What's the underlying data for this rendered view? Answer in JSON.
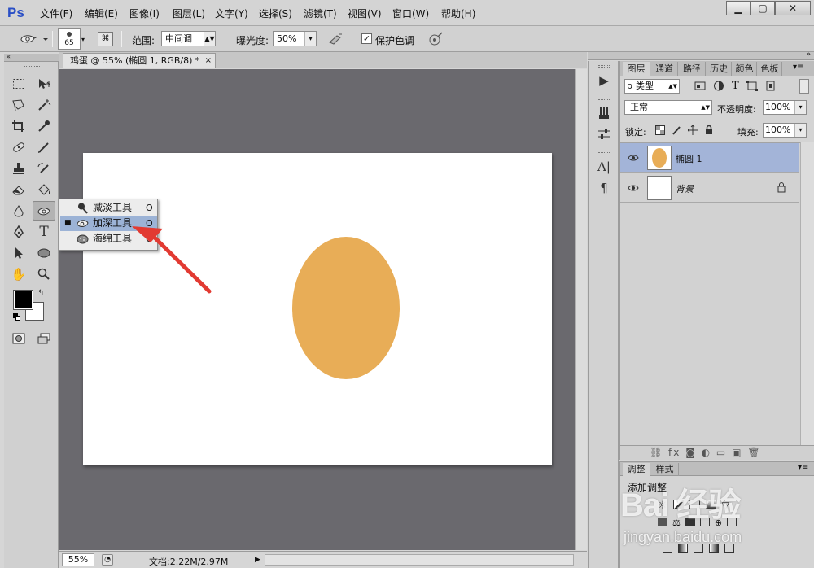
{
  "app": {
    "logo": "Ps"
  },
  "menu": [
    {
      "label": "文件(F)"
    },
    {
      "label": "编辑(E)"
    },
    {
      "label": "图像(I)"
    },
    {
      "label": "图层(L)"
    },
    {
      "label": "文字(Y)"
    },
    {
      "label": "选择(S)"
    },
    {
      "label": "滤镜(T)"
    },
    {
      "label": "视图(V)"
    },
    {
      "label": "窗口(W)"
    },
    {
      "label": "帮助(H)"
    }
  ],
  "window_controls": {
    "minimize": "▁",
    "maximize": "▢",
    "close": "✕"
  },
  "options": {
    "brush_size": "65",
    "range_label": "范围:",
    "range_value": "中间调",
    "exposure_label": "曝光度:",
    "exposure_value": "50%",
    "protect_tones_label": "保护色调",
    "protect_tones_checked": "✓"
  },
  "document": {
    "tab_title": "鸡蛋 @ 55% (椭圆 1, RGB/8) *",
    "tab_close": "×",
    "egg_color": "#e8ad57",
    "zoom": "55%",
    "doc_size": "文档:2.22M/2.97M"
  },
  "flyout": {
    "items": [
      {
        "label": "减淡工具",
        "shortcut": "O",
        "selected": false,
        "icon": "dodge-icon"
      },
      {
        "label": "加深工具",
        "shortcut": "O",
        "selected": true,
        "icon": "burn-icon"
      },
      {
        "label": "海绵工具",
        "shortcut": "O",
        "selected": false,
        "icon": "sponge-icon"
      }
    ],
    "bullet": "■"
  },
  "tools": {
    "type_tool": "T",
    "hand_tool": "✋",
    "zoom_tool": "🔍"
  },
  "layers_panel": {
    "tabs": [
      "图层",
      "通道",
      "路径",
      "历史",
      "颜色",
      "色板"
    ],
    "filter_label": "类型",
    "blend_mode": "正常",
    "opacity_label": "不透明度:",
    "opacity_value": "100%",
    "lock_label": "锁定:",
    "fill_label": "填充:",
    "fill_value": "100%",
    "layers": [
      {
        "name": "椭圆 1",
        "selected": true,
        "locked": false
      },
      {
        "name": "背景",
        "selected": false,
        "locked": true
      }
    ],
    "footer_icons": "⛓  fx  ◙  ◐  ▭  ▣  🗑"
  },
  "adjustments_panel": {
    "tabs": [
      "调整",
      "样式"
    ],
    "title": "添加调整"
  },
  "watermark": {
    "logo": "Bai 经验",
    "url": "jingyan.baidu.com"
  },
  "colors": {
    "selection_blue": "#a3b4d8",
    "annotation_red": "#e23a32",
    "canvas_background": "#6a696e"
  }
}
